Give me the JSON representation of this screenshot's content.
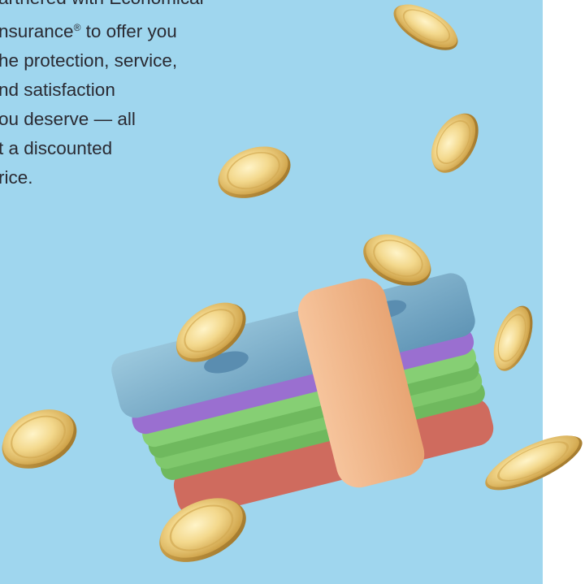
{
  "copy": {
    "lines": [
      "artnered with Economical",
      "nsurance",
      "he protection, service,",
      "nd satisfaction",
      "ou deserve — all",
      "t a discounted",
      "rice."
    ],
    "registered_mark": "®",
    "line2_tail": " to offer you"
  },
  "colors": {
    "background": "#9fd6ee",
    "page": "#ffffff",
    "text": "#2a2a32",
    "coin_gold": "#e9c572",
    "band_peach": "#f2b48a",
    "bill_blue": "#7fb3cf",
    "bill_purple": "#9a6fd0",
    "bill_green": "#79c46a",
    "bill_red": "#cf6b5e"
  },
  "illustration": {
    "subject": "stack of money bills with a peach band and floating gold coins",
    "icons": [
      "money-stack-icon",
      "gold-coin-icon"
    ]
  }
}
